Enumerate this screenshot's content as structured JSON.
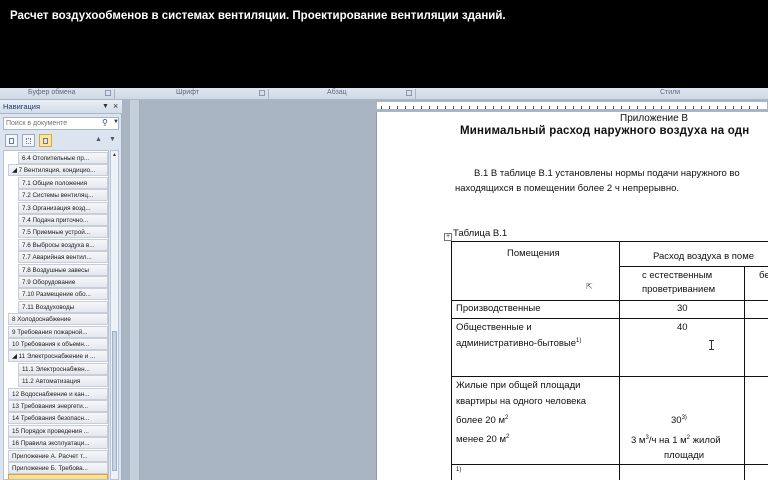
{
  "video_title": "Расчет воздухообменов в системах вентиляции. Проектирование вентиляции зданий.",
  "ribbon": {
    "groups": [
      "Буфер обмена",
      "Шрифт",
      "Абзац",
      "Стили"
    ]
  },
  "navigation": {
    "title": "Навигация",
    "search_placeholder": "Поиск в документе",
    "items": [
      {
        "label": "6.4 Отопительные пр...",
        "level": 2
      },
      {
        "label": "◢ 7 Вентиляция, кондицио...",
        "level": 1
      },
      {
        "label": "7.1 Общие положения",
        "level": 2
      },
      {
        "label": "7.2 Системы вентиляц...",
        "level": 2
      },
      {
        "label": "7.3 Организация возд...",
        "level": 2
      },
      {
        "label": "7.4 Подача приточно...",
        "level": 2
      },
      {
        "label": "7.5 Приемные устрой...",
        "level": 2
      },
      {
        "label": "7.6 Выбросы воздуха в...",
        "level": 2
      },
      {
        "label": "7.7 Аварийная вентил...",
        "level": 2
      },
      {
        "label": "7.8 Воздушные завесы",
        "level": 2
      },
      {
        "label": "7.9 Оборудование",
        "level": 2
      },
      {
        "label": "7.10 Размещение обо...",
        "level": 2
      },
      {
        "label": "7.11 Воздуховоды",
        "level": 2
      },
      {
        "label": "8 Холодоснабжение",
        "level": 1
      },
      {
        "label": "9 Требования пожарной...",
        "level": 1
      },
      {
        "label": "10 Требования к объемн...",
        "level": 1
      },
      {
        "label": "◢ 11 Электроснабжение и ...",
        "level": 1
      },
      {
        "label": "11.1 Электроснабжен...",
        "level": 2
      },
      {
        "label": "11.2 Автоматизация",
        "level": 2
      },
      {
        "label": "12 Водоснабжение и кан...",
        "level": 1
      },
      {
        "label": "13 Требования энергети...",
        "level": 1
      },
      {
        "label": "14 Требования безопасн...",
        "level": 1
      },
      {
        "label": "15 Порядок проведения ...",
        "level": 1
      },
      {
        "label": "16 Правила эксплуатаци...",
        "level": 1
      },
      {
        "label": "Приложение А. Расчет т...",
        "level": 1
      },
      {
        "label": "Приложение Б. Требова...",
        "level": 1
      },
      {
        "label": "",
        "level": 1,
        "selected": true
      }
    ]
  },
  "document": {
    "appendix": "Приложение В",
    "title": "Минимальный расход наружного воздуха на одн",
    "para_line1": "В.1 В таблице В.1 установлены нормы подачи наружного во",
    "para_line2": "находящихся в помещении более 2 ч непрерывно.",
    "table_caption": "Таблица В.1",
    "table": {
      "col_premises": "Помещения",
      "col_flow": "Расход воздуха в поме",
      "col_natural_1": "с естественным",
      "col_natural_2": "проветриванием",
      "col_third": "бе",
      "row1_name": "Производственные",
      "row1_value": "30",
      "row2_name_1": "Общественные и",
      "row2_name_2": "административно-бытовые",
      "row2_sup": "1)",
      "row2_value": "40",
      "row3_name_1": "Жилые при общей площади",
      "row3_name_2": "квартиры на одного человека",
      "row3_more": "более 20 м",
      "row3_more_sup": "2",
      "row3_less": "менее 20 м",
      "row3_less_sup": "2",
      "row3_value1": "30",
      "row3_value1_sup": "3)",
      "row3_value2_a": "3 м",
      "row3_value2_sup1": "3",
      "row3_value2_b": "/ч на 1 м",
      "row3_value2_sup2": "2",
      "row3_value2_c": " жилой",
      "row3_value2_d": "площади",
      "footnote_mark": "1)"
    }
  }
}
